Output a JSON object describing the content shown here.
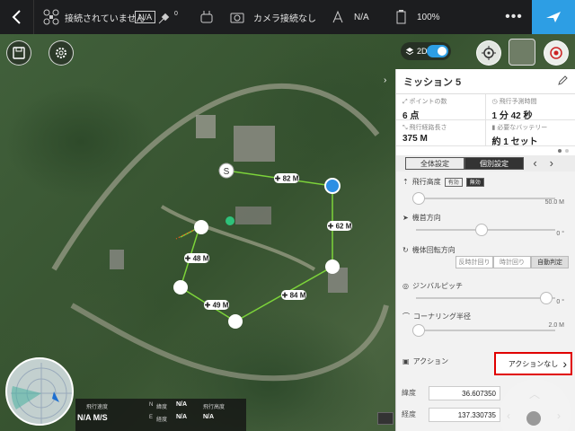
{
  "topbar": {
    "connection": "接続されていません",
    "gps_badge": "N/A",
    "satellites": "0",
    "camera": "カメラ接続なし",
    "drone_battery": "N/A",
    "device_battery": "100%",
    "more_icon": "more-dots-icon",
    "fly_icon": "airplane-icon"
  },
  "map": {
    "mode_label": "2D",
    "mode_switch_on": true,
    "start_label": "S",
    "distances": [
      "82 M",
      "62 M",
      "48 M",
      "84 M",
      "49 M"
    ]
  },
  "panel": {
    "title": "ミッション 5",
    "stats": [
      {
        "label": "ポイントの数",
        "value": "6 点"
      },
      {
        "label": "飛行予測時間",
        "value": "1 分 42 秒"
      },
      {
        "label": "飛行経路長さ",
        "value": "375 M"
      },
      {
        "label": "必要なバッテリー",
        "value": "約 1 セット"
      }
    ],
    "tabs": [
      "全体設定",
      "個別設定"
    ],
    "altitude": {
      "label": "飛行高度",
      "btn_on": "有効",
      "btn_off": "無効",
      "value": "50.0 M"
    },
    "heading": {
      "label": "機首方向",
      "value": "0 °"
    },
    "rotation": {
      "label": "機体回転方向",
      "options": [
        "反時計回り",
        "時計回り",
        "自動判定"
      ],
      "selected": "自動判定"
    },
    "gimbal": {
      "label": "ジンバルピッチ",
      "value": "0 °"
    },
    "cornering": {
      "label": "コーナリング半径",
      "value": "2.0 M"
    },
    "action": {
      "label": "アクション",
      "value": "アクションなし"
    },
    "latitude": {
      "label": "緯度",
      "value": "36.607350"
    },
    "longitude": {
      "label": "経度",
      "value": "137.330735"
    }
  },
  "telemetry": {
    "hspeed_label": "飛行速度",
    "hspeed_value": "N/A M/S",
    "lat_label": "緯度",
    "lon_label": "経度",
    "lat_value": "N/A",
    "lon_value": "N/A",
    "vspeed_label": "飛行高度",
    "vspeed_value": "N/A",
    "n_label": "N",
    "e_label": "E"
  }
}
